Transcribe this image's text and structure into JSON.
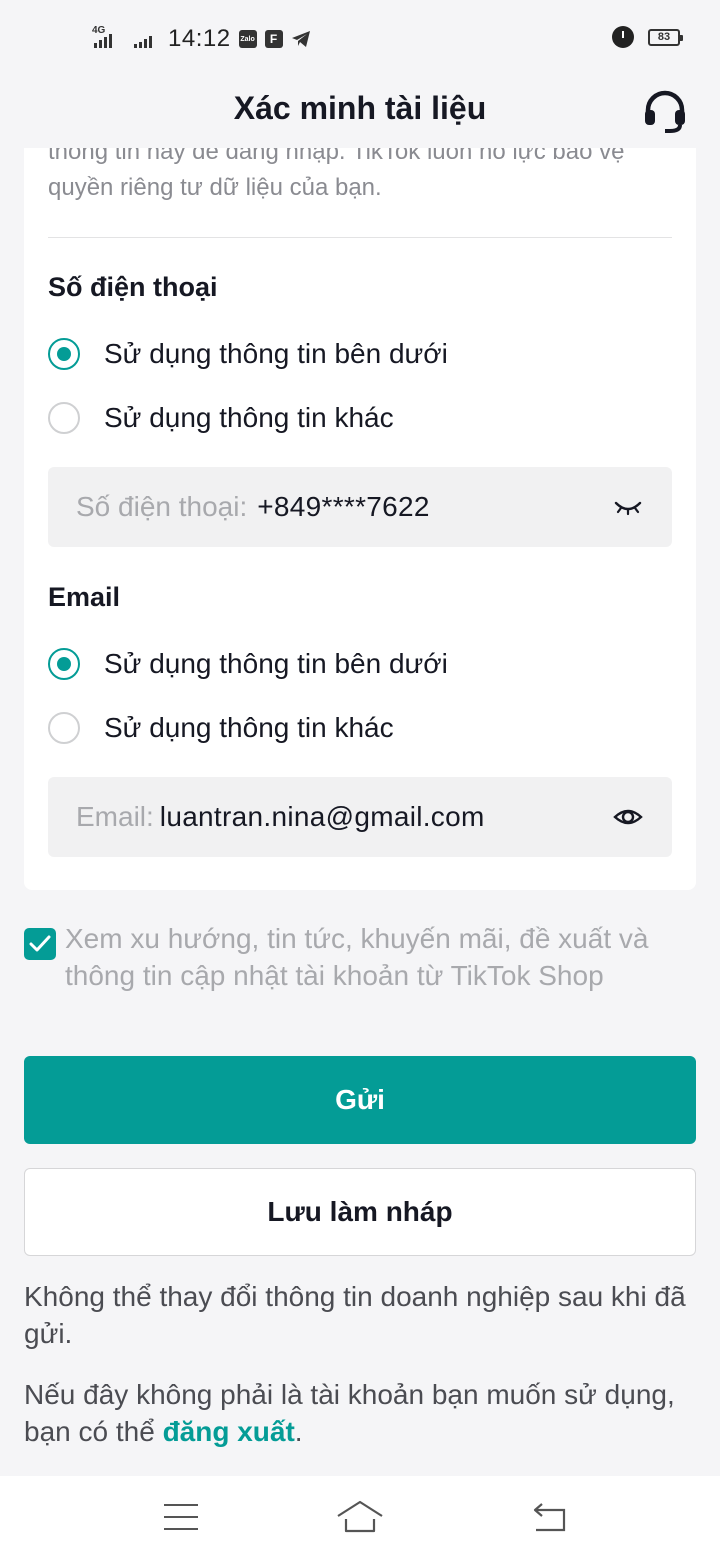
{
  "status_bar": {
    "network_tag": "4G",
    "time": "14:12",
    "app_badges": [
      "Zalo",
      "F"
    ],
    "battery": "83"
  },
  "header": {
    "title": "Xác minh tài liệu",
    "support_icon": "headset-icon"
  },
  "intro": {
    "text": "thông tin này để đăng nhập. TikTok luôn nỗ lực bảo vệ quyền riêng tư dữ liệu của bạn."
  },
  "phone_section": {
    "title": "Số điện thoại",
    "options": [
      {
        "label": "Sử dụng thông tin bên dưới",
        "selected": true
      },
      {
        "label": "Sử dụng thông tin khác",
        "selected": false
      }
    ],
    "field_label": "Số điện thoại:",
    "field_value": "+849****7622",
    "toggle_icon": "eye-closed-icon"
  },
  "email_section": {
    "title": "Email",
    "options": [
      {
        "label": "Sử dụng thông tin bên dưới",
        "selected": true
      },
      {
        "label": "Sử dụng thông tin khác",
        "selected": false
      }
    ],
    "field_label": "Email:",
    "field_value": "luantran.nina@gmail.com",
    "toggle_icon": "eye-open-icon"
  },
  "subscribe": {
    "checked": true,
    "text": "Xem xu hướng, tin tức, khuyến mãi, đề xuất và thông tin cập nhật tài khoản từ TikTok Shop"
  },
  "buttons": {
    "submit": "Gửi",
    "save_draft": "Lưu làm nháp"
  },
  "notes": {
    "cannot_change": "Không thể thay đổi thông tin doanh nghiệp sau khi đã gửi.",
    "logout_prefix": "Nếu đây không phải là tài khoản bạn muốn sử dụng, bạn có thể ",
    "logout_link": "đăng xuất",
    "logout_suffix": "."
  },
  "colors": {
    "accent": "#049c96",
    "background": "#f5f5f7",
    "card": "#ffffff"
  }
}
